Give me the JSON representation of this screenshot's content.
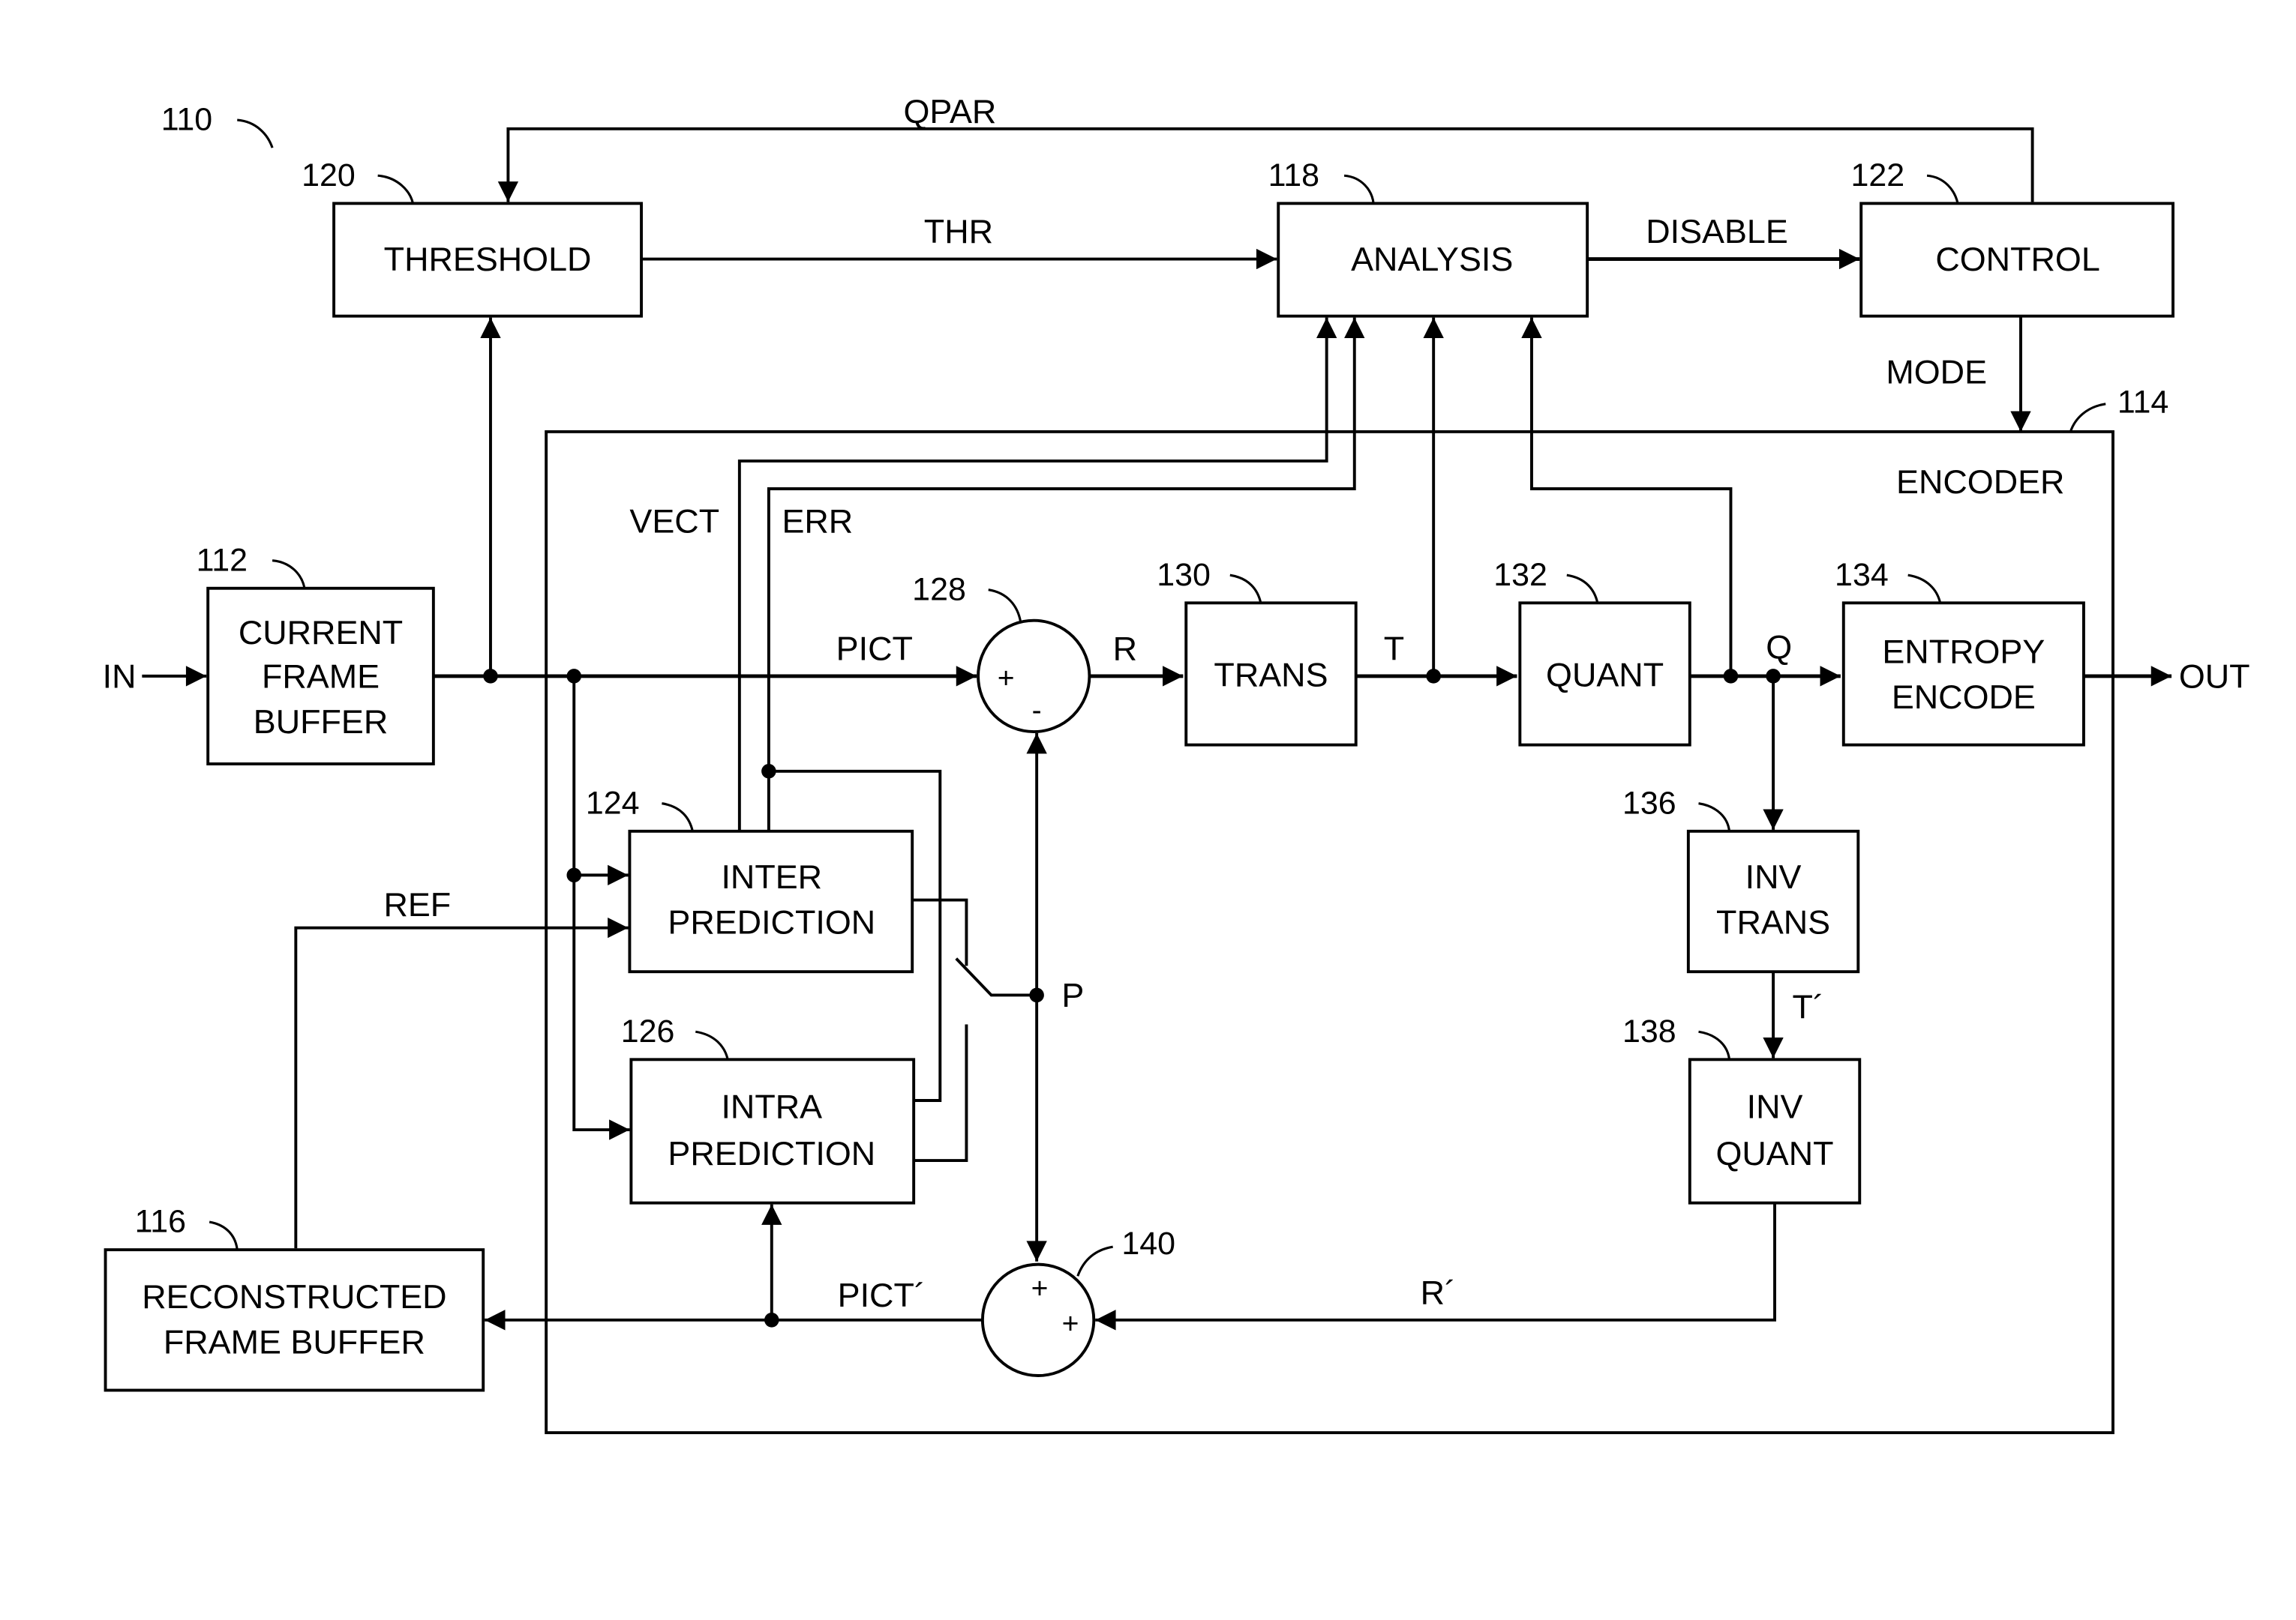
{
  "figure": {
    "system_ref": "110",
    "blocks": {
      "threshold": {
        "ref": "120",
        "lines": [
          "THRESHOLD"
        ]
      },
      "analysis": {
        "ref": "118",
        "lines": [
          "ANALYSIS"
        ]
      },
      "control": {
        "ref": "122",
        "lines": [
          "CONTROL"
        ]
      },
      "current_frame_buffer": {
        "ref": "112",
        "lines": [
          "CURRENT",
          "FRAME",
          "BUFFER"
        ]
      },
      "encoder": {
        "ref": "114",
        "lines": [
          "ENCODER"
        ]
      },
      "subtractor": {
        "ref": "128",
        "signs": [
          "+",
          "-"
        ]
      },
      "trans": {
        "ref": "130",
        "lines": [
          "TRANS"
        ]
      },
      "quant": {
        "ref": "132",
        "lines": [
          "QUANT"
        ]
      },
      "entropy_encode": {
        "ref": "134",
        "lines": [
          "ENTROPY",
          "ENCODE"
        ]
      },
      "inter_prediction": {
        "ref": "124",
        "lines": [
          "INTER",
          "PREDICTION"
        ]
      },
      "intra_prediction": {
        "ref": "126",
        "lines": [
          "INTRA",
          "PREDICTION"
        ]
      },
      "inv_trans": {
        "ref": "136",
        "lines": [
          "INV",
          "TRANS"
        ]
      },
      "inv_quant": {
        "ref": "138",
        "lines": [
          "INV",
          "QUANT"
        ]
      },
      "adder": {
        "ref": "140",
        "signs": [
          "+",
          "+"
        ]
      },
      "reconstructed_frame_buffer": {
        "ref": "116",
        "lines": [
          "RECONSTRUCTED",
          "FRAME BUFFER"
        ]
      }
    },
    "signals": {
      "qpar": "QPAR",
      "thr": "THR",
      "disable": "DISABLE",
      "mode": "MODE",
      "in": "IN",
      "out": "OUT",
      "vect": "VECT",
      "err": "ERR",
      "pict": "PICT",
      "r": "R",
      "t": "T",
      "q": "Q",
      "ref": "REF",
      "p": "P",
      "t_prime": "T´",
      "pict_prime": "PICT´",
      "r_prime": "R´"
    }
  }
}
